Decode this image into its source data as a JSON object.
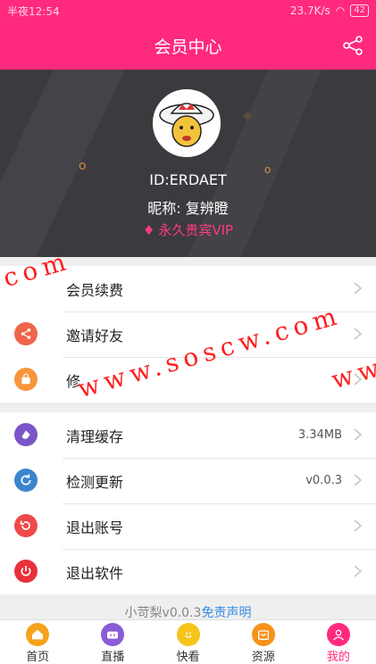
{
  "status": {
    "left": "半夜12:54",
    "right": "23.7K/s",
    "battery": "42"
  },
  "header": {
    "title": "会员中心"
  },
  "profile": {
    "id_text": "ID:ERDAET",
    "nickname": "昵称: 复辨瞪",
    "vip_text": "永久贵宾VIP"
  },
  "menu1": [
    {
      "label": "会员续费",
      "icon": "crown-icon",
      "color": "#ffffff"
    },
    {
      "label": "邀请好友",
      "icon": "share-icon",
      "color": "#f0654a"
    },
    {
      "label": "修",
      "icon": "bag-icon",
      "color": "#f7953a"
    }
  ],
  "menu2": [
    {
      "label": "清理缓存",
      "value": "3.34MB",
      "icon": "eraser-icon",
      "color": "#7b55c7"
    },
    {
      "label": "检测更新",
      "value": "v0.0.3",
      "icon": "refresh-icon",
      "color": "#3b85cf"
    },
    {
      "label": "退出账号",
      "value": "",
      "icon": "logout-icon",
      "color": "#ef4a4a"
    },
    {
      "label": "退出软件",
      "value": "",
      "icon": "power-icon",
      "color": "#e8313a"
    }
  ],
  "footer": {
    "text": "小苛梨v0.0.3",
    "link": "免责声明"
  },
  "tabs": [
    {
      "label": "首页",
      "color": "#f7a21b"
    },
    {
      "label": "直播",
      "color": "#8a5cd6"
    },
    {
      "label": "快看",
      "color": "#f7c41b"
    },
    {
      "label": "资源",
      "color": "#f7931b"
    },
    {
      "label": "我的",
      "color": "#ff2a7e"
    }
  ],
  "watermarks": [
    ".com",
    "www.soscw.com",
    "www"
  ]
}
